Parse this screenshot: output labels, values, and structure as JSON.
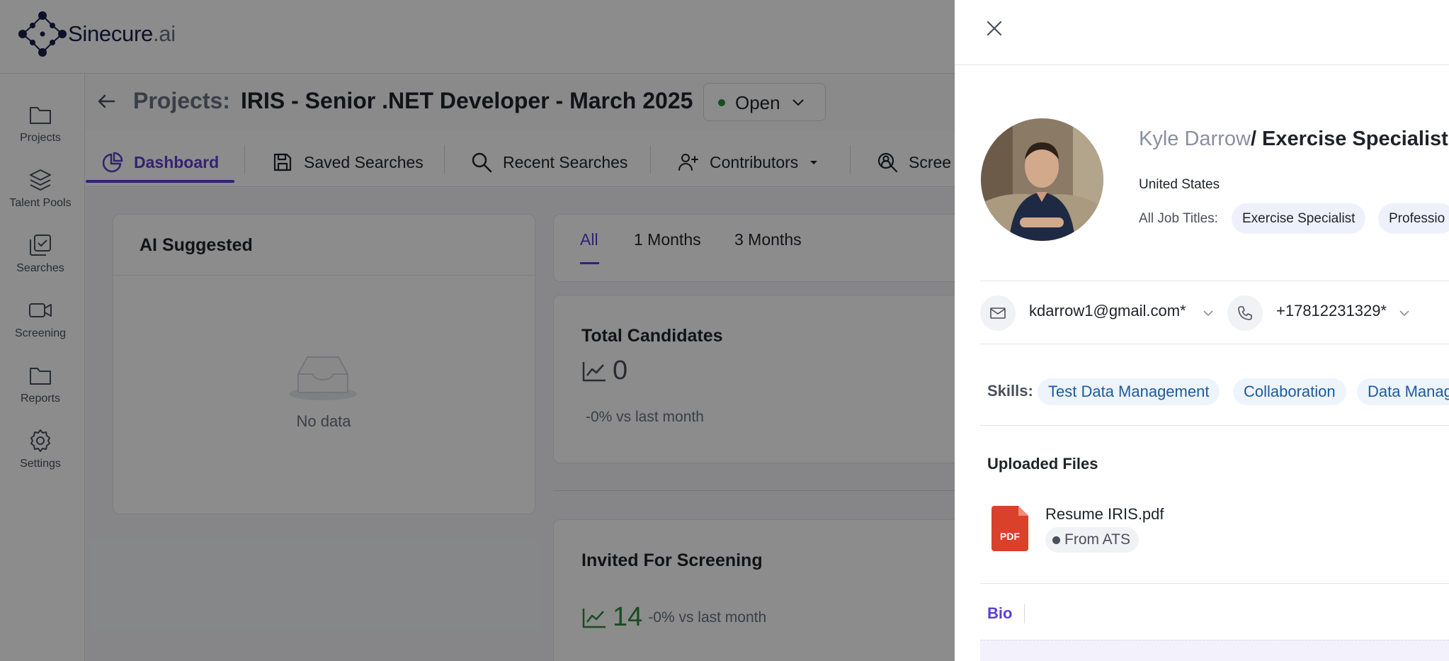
{
  "app": {
    "brand": "Sinecure",
    "brand_suffix": ".ai"
  },
  "sidebar": {
    "items": [
      {
        "label": "Projects",
        "icon": "folder-icon"
      },
      {
        "label": "Talent Pools",
        "icon": "layers-icon"
      },
      {
        "label": "Searches",
        "icon": "search-check-icon"
      },
      {
        "label": "Screening",
        "icon": "video-icon"
      },
      {
        "label": "Reports",
        "icon": "folder-icon"
      },
      {
        "label": "Settings",
        "icon": "gear-icon"
      }
    ]
  },
  "header": {
    "label": "Projects:",
    "title": "IRIS - Senior .NET Developer - March 2025",
    "status": "Open",
    "status_color": "#2e8b3d"
  },
  "tabs": [
    {
      "label": "Dashboard",
      "active": true
    },
    {
      "label": "Saved Searches"
    },
    {
      "label": "Recent Searches"
    },
    {
      "label": "Contributors"
    },
    {
      "label": "Scree"
    }
  ],
  "ai_card": {
    "title": "AI Suggested",
    "empty_text": "No data"
  },
  "period_tabs": [
    "All",
    "1 Months",
    "3 Months"
  ],
  "stats": {
    "total": {
      "title": "Total Candidates",
      "value": "0",
      "sub": "-0% vs last month"
    },
    "invited": {
      "title": "Invited For Screening",
      "value": "14",
      "sub": "-0% vs last month"
    }
  },
  "candidate": {
    "name": "Kyle Darrow",
    "role": "/ Exercise Specialist",
    "location": "United States",
    "job_titles_label": "All Job Titles:",
    "job_titles": [
      "Exercise Specialist",
      "Professio"
    ],
    "email": "kdarrow1@gmail.com*",
    "phone": "+17812231329*",
    "skills_label": "Skills:",
    "skills": [
      "Test Data Management",
      "Collaboration",
      "Data Manag"
    ],
    "files_title": "Uploaded Files",
    "file_name": "Resume IRIS.pdf",
    "file_source": "From ATS",
    "file_type": "PDF",
    "bio_tab": "Bio"
  },
  "colors": {
    "accent": "#5b3fd1",
    "success": "#2e8b3d",
    "pdf": "#d9412b"
  }
}
